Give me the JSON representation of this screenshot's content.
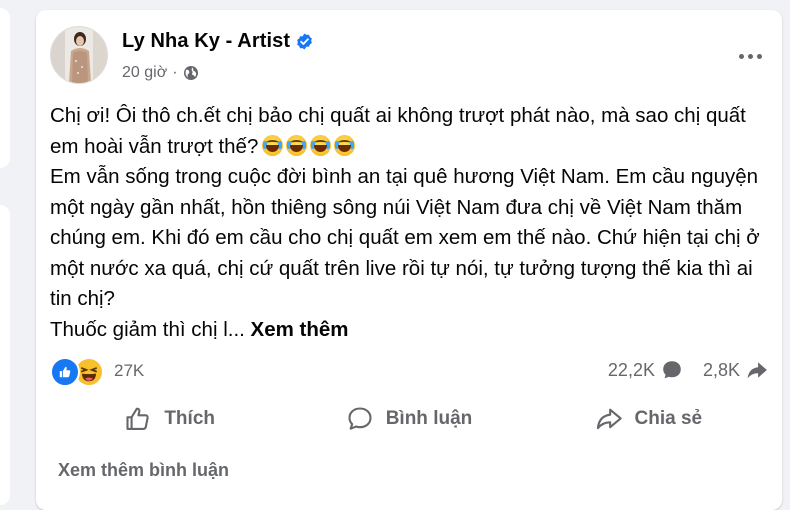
{
  "post": {
    "author": "Ly Nha Ky - Artist",
    "time": "20 giờ",
    "separator": "·",
    "paragraphs": [
      "Chị ơi! Ôi thô ch.ết chị bảo chị quất ai không trượt phát nào, mà sao chị quất em hoài vẫn trượt thế?",
      "Em vẫn sống trong cuộc đời bình an tại quê hương Việt Nam. Em cầu nguyện một ngày gần nhất, hồn thiêng sông núi Việt Nam đưa chị về Việt Nam thăm chúng em. Khi đó em cầu cho chị quất em xem em thế nào. Chứ hiện tại chị ở một nước xa quá, chị cứ quất trên live rồi tự nói, tự tưởng tượng thế kia thì ai tin chị?",
      "Thuốc giảm thì chị l..."
    ],
    "see_more": "Xem thêm",
    "emoji_icons": [
      "tears-of-joy-icon",
      "tears-of-joy-icon",
      "tears-of-joy-icon",
      "tears-of-joy-icon"
    ]
  },
  "stats": {
    "reactions_count": "27K",
    "reaction_icons": [
      "like-icon",
      "haha-icon"
    ],
    "comments_count": "22,2K",
    "shares_count": "2,8K"
  },
  "actions": {
    "like": "Thích",
    "comment": "Bình luận",
    "share": "Chia sẻ"
  },
  "footer": {
    "view_more_comments": "Xem thêm bình luận"
  },
  "colors": {
    "background": "#f0f2f5",
    "card": "#ffffff",
    "text_primary": "#050505",
    "text_secondary": "#65676b",
    "brand_blue": "#1877f2",
    "haha_yellow": "#f7c02c"
  }
}
